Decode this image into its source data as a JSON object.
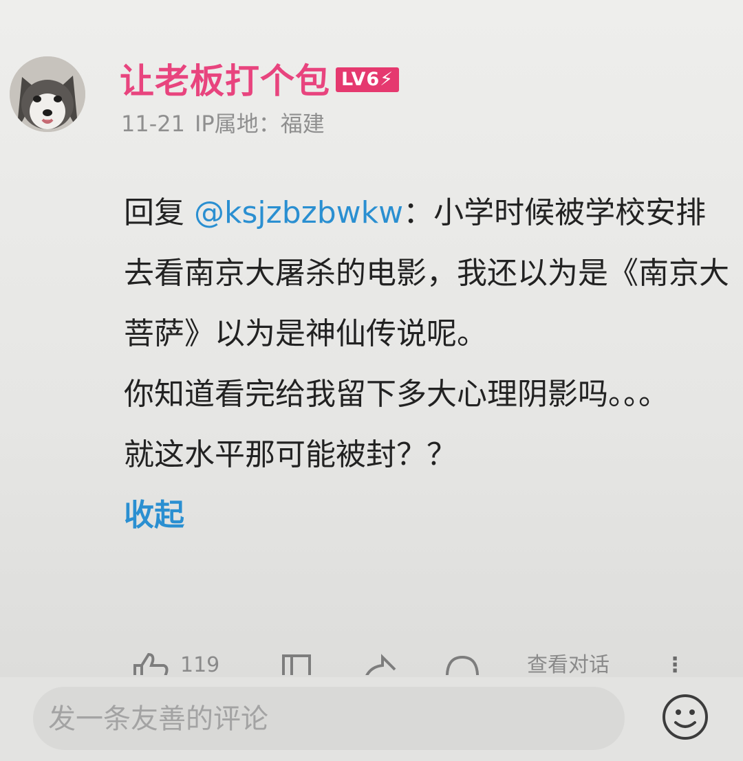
{
  "post": {
    "username": "让老板打个包",
    "level_badge": "LV6⚡",
    "date": "11-21",
    "ip_location": "IP属地：福建",
    "reply_prefix": "回复 ",
    "mention": "@ksjzbzbwkw",
    "reply_text": "：小学时候被学校安排去看南京大屠杀的电影，我还以为是《南京大菩萨》以为是神仙传说呢。",
    "line2": "你知道看完给我留下多大心理阴影吗。。。",
    "line3": "就这水平那可能被封？？",
    "collapse_label": "收起"
  },
  "actions": {
    "like_count": "119",
    "view_dialog_label": "查看对话",
    "more_label": "⋮"
  },
  "composer": {
    "placeholder": "发一条友善的评论"
  },
  "colors": {
    "username": "#e8447e",
    "badge": "#e5396f",
    "link": "#2a8fd1",
    "meta": "#8f8f8f",
    "body": "#222222"
  }
}
